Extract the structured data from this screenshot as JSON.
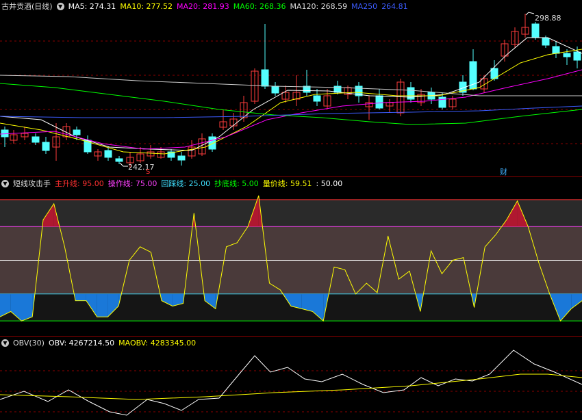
{
  "price_pane": {
    "title": "古井贡酒(日线)",
    "ma": [
      {
        "label": "MA5: 274.31",
        "color": "#ffffff"
      },
      {
        "label": "MA10: 277.52",
        "color": "#ffff00"
      },
      {
        "label": "MA20: 281.93",
        "color": "#ff00ff"
      },
      {
        "label": "MA60: 268.36",
        "color": "#00ff00"
      },
      {
        "label": "MA120: 268.59",
        "color": "#dddddd"
      },
      {
        "label": "MA250",
        "color": "#3c5cff"
      },
      {
        "label": "264.81",
        "color": "#3c5cff"
      }
    ],
    "high_label": "298.88",
    "low_label": "242.17",
    "marker_s": "S",
    "marker_cai": "财"
  },
  "indicator_pane": {
    "title": "短线攻击手",
    "items": [
      {
        "label": "主升线: 95.00",
        "color": "#ff3030"
      },
      {
        "label": "操作线: 75.00",
        "color": "#ff40ff"
      },
      {
        "label": "回踩线: 25.00",
        "color": "#40e0ff"
      },
      {
        "label": "抄底线: 5.00",
        "color": "#00ff00"
      },
      {
        "label": "量价线: 59.51",
        "color": "#ffff00"
      },
      {
        "label": ": 50.00",
        "color": "#ffffff"
      }
    ],
    "line_values": [
      8,
      12,
      5,
      8,
      80,
      92,
      60,
      20,
      20,
      8,
      8,
      16,
      50,
      60,
      56,
      20,
      16,
      18,
      85,
      20,
      14,
      60,
      63,
      75,
      98,
      33,
      28,
      16,
      14,
      12,
      5,
      45,
      43,
      25,
      33,
      26,
      68,
      36,
      42,
      12,
      57,
      40,
      50,
      52,
      15,
      60,
      69,
      80,
      94,
      75,
      48,
      25,
      5,
      14,
      20
    ]
  },
  "obv_pane": {
    "title": "OBV(30)",
    "obv_label": "OBV: 4267214.50",
    "maobv_label": "MAOBV: 4283345.00"
  },
  "colors": {
    "up": "#ff3c3c",
    "down": "#54ffff",
    "border": "#8b0000"
  }
}
